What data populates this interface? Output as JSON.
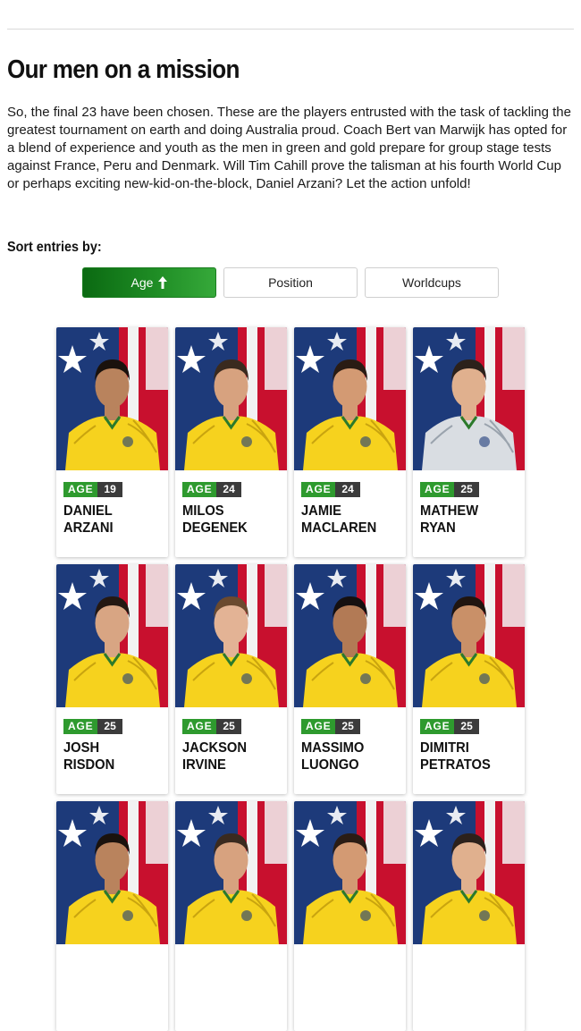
{
  "article": {
    "title": "Our men on a mission",
    "intro": "So, the final 23 have been chosen. These are the players entrusted with the task of tackling the greatest tournament on earth and doing Australia proud. Coach Bert van Marwijk has opted for a blend of experience and youth as the men in green and gold prepare for group stage tests against France, Peru and Denmark. Will Tim Cahill prove the talisman at his fourth World Cup or perhaps exciting new-kid-on-the-block, Daniel Arzani? Let the action unfold!"
  },
  "sort": {
    "label": "Sort entries by:",
    "options": [
      {
        "label": "Age",
        "active": true,
        "icon": "arrow-up-icon"
      },
      {
        "label": "Position",
        "active": false
      },
      {
        "label": "Worldcups",
        "active": false
      }
    ]
  },
  "badge_label": "AGE",
  "colors": {
    "accent_green": "#2e9a2e",
    "badge_dark": "#3b3b3b",
    "kit_yellow": "#f6d21e"
  },
  "players": [
    {
      "first": "DANIEL",
      "last": "ARZANI",
      "age": "19",
      "kit": "yellow"
    },
    {
      "first": "MILOS",
      "last": "DEGENEK",
      "age": "24",
      "kit": "yellow"
    },
    {
      "first": "JAMIE",
      "last": "MACLAREN",
      "age": "24",
      "kit": "yellow"
    },
    {
      "first": "MATHEW",
      "last": "RYAN",
      "age": "25",
      "kit": "grey"
    },
    {
      "first": "JOSH",
      "last": "RISDON",
      "age": "25",
      "kit": "yellow"
    },
    {
      "first": "JACKSON",
      "last": "IRVINE",
      "age": "25",
      "kit": "yellow"
    },
    {
      "first": "MASSIMO",
      "last": "LUONGO",
      "age": "25",
      "kit": "yellow"
    },
    {
      "first": "DIMITRI",
      "last": "PETRATOS",
      "age": "25",
      "kit": "yellow"
    },
    {
      "first": "",
      "last": "",
      "age": "",
      "kit": "yellow"
    },
    {
      "first": "",
      "last": "",
      "age": "",
      "kit": "yellow"
    },
    {
      "first": "",
      "last": "",
      "age": "",
      "kit": "yellow"
    },
    {
      "first": "",
      "last": "",
      "age": "",
      "kit": "yellow"
    }
  ]
}
